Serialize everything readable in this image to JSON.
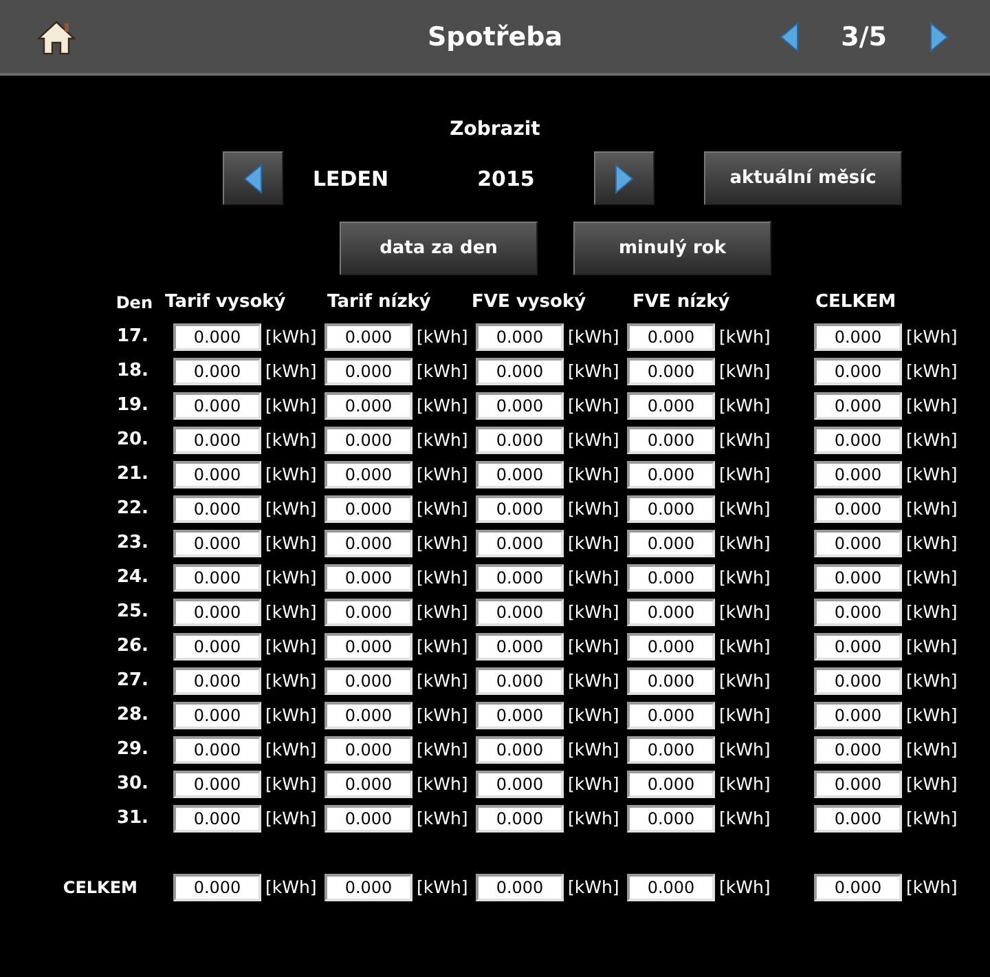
{
  "top_bar": {
    "title": "Spotřeba",
    "page": "3/5"
  },
  "period": {
    "label": "Zobrazit",
    "month": "LEDEN",
    "year": "2015",
    "buttons": [
      "aktuální měsíc",
      "data za den",
      "minulý rok"
    ]
  },
  "table": {
    "day_header": "Den",
    "columns": [
      "Tarif vysoký",
      "Tarif nízký",
      "FVE vysoký",
      "FVE nízký",
      "CELKEM"
    ],
    "rows": [
      {
        "day": "17.",
        "cells": [
          {
            "value": "0.000",
            "unit": "[kWh]"
          },
          {
            "value": "0.000",
            "unit": "[kWh]"
          },
          {
            "value": "0.000",
            "unit": "[kWh]"
          },
          {
            "value": "0.000",
            "unit": "[kWh]"
          },
          {
            "value": "0.000",
            "unit": "[kWh]"
          }
        ]
      },
      {
        "day": "18.",
        "cells": [
          {
            "value": "0.000",
            "unit": "[kWh]"
          },
          {
            "value": "0.000",
            "unit": "[kWh]"
          },
          {
            "value": "0.000",
            "unit": "[kWh]"
          },
          {
            "value": "0.000",
            "unit": "[kWh]"
          },
          {
            "value": "0.000",
            "unit": "[kWh]"
          }
        ]
      },
      {
        "day": "19.",
        "cells": [
          {
            "value": "0.000",
            "unit": "[kWh]"
          },
          {
            "value": "0.000",
            "unit": "[kWh]"
          },
          {
            "value": "0.000",
            "unit": "[kWh]"
          },
          {
            "value": "0.000",
            "unit": "[kWh]"
          },
          {
            "value": "0.000",
            "unit": "[kWh]"
          }
        ]
      },
      {
        "day": "20.",
        "cells": [
          {
            "value": "0.000",
            "unit": "[kWh]"
          },
          {
            "value": "0.000",
            "unit": "[kWh]"
          },
          {
            "value": "0.000",
            "unit": "[kWh]"
          },
          {
            "value": "0.000",
            "unit": "[kWh]"
          },
          {
            "value": "0.000",
            "unit": "[kWh]"
          }
        ]
      },
      {
        "day": "21.",
        "cells": [
          {
            "value": "0.000",
            "unit": "[kWh]"
          },
          {
            "value": "0.000",
            "unit": "[kWh]"
          },
          {
            "value": "0.000",
            "unit": "[kWh]"
          },
          {
            "value": "0.000",
            "unit": "[kWh]"
          },
          {
            "value": "0.000",
            "unit": "[kWh]"
          }
        ]
      },
      {
        "day": "22.",
        "cells": [
          {
            "value": "0.000",
            "unit": "[kWh]"
          },
          {
            "value": "0.000",
            "unit": "[kWh]"
          },
          {
            "value": "0.000",
            "unit": "[kWh]"
          },
          {
            "value": "0.000",
            "unit": "[kWh]"
          },
          {
            "value": "0.000",
            "unit": "[kWh]"
          }
        ]
      },
      {
        "day": "23.",
        "cells": [
          {
            "value": "0.000",
            "unit": "[kWh]"
          },
          {
            "value": "0.000",
            "unit": "[kWh]"
          },
          {
            "value": "0.000",
            "unit": "[kWh]"
          },
          {
            "value": "0.000",
            "unit": "[kWh]"
          },
          {
            "value": "0.000",
            "unit": "[kWh]"
          }
        ]
      },
      {
        "day": "24.",
        "cells": [
          {
            "value": "0.000",
            "unit": "[kWh]"
          },
          {
            "value": "0.000",
            "unit": "[kWh]"
          },
          {
            "value": "0.000",
            "unit": "[kWh]"
          },
          {
            "value": "0.000",
            "unit": "[kWh]"
          },
          {
            "value": "0.000",
            "unit": "[kWh]"
          }
        ]
      },
      {
        "day": "25.",
        "cells": [
          {
            "value": "0.000",
            "unit": "[kWh]"
          },
          {
            "value": "0.000",
            "unit": "[kWh]"
          },
          {
            "value": "0.000",
            "unit": "[kWh]"
          },
          {
            "value": "0.000",
            "unit": "[kWh]"
          },
          {
            "value": "0.000",
            "unit": "[kWh]"
          }
        ]
      },
      {
        "day": "26.",
        "cells": [
          {
            "value": "0.000",
            "unit": "[kWh]"
          },
          {
            "value": "0.000",
            "unit": "[kWh]"
          },
          {
            "value": "0.000",
            "unit": "[kWh]"
          },
          {
            "value": "0.000",
            "unit": "[kWh]"
          },
          {
            "value": "0.000",
            "unit": "[kWh]"
          }
        ]
      },
      {
        "day": "27.",
        "cells": [
          {
            "value": "0.000",
            "unit": "[kWh]"
          },
          {
            "value": "0.000",
            "unit": "[kWh]"
          },
          {
            "value": "0.000",
            "unit": "[kWh]"
          },
          {
            "value": "0.000",
            "unit": "[kWh]"
          },
          {
            "value": "0.000",
            "unit": "[kWh]"
          }
        ]
      },
      {
        "day": "28.",
        "cells": [
          {
            "value": "0.000",
            "unit": "[kWh]"
          },
          {
            "value": "0.000",
            "unit": "[kWh]"
          },
          {
            "value": "0.000",
            "unit": "[kWh]"
          },
          {
            "value": "0.000",
            "unit": "[kWh]"
          },
          {
            "value": "0.000",
            "unit": "[kWh]"
          }
        ]
      },
      {
        "day": "29.",
        "cells": [
          {
            "value": "0.000",
            "unit": "[kWh]"
          },
          {
            "value": "0.000",
            "unit": "[kWh]"
          },
          {
            "value": "0.000",
            "unit": "[kWh]"
          },
          {
            "value": "0.000",
            "unit": "[kWh]"
          },
          {
            "value": "0.000",
            "unit": "[kWh]"
          }
        ]
      },
      {
        "day": "30.",
        "cells": [
          {
            "value": "0.000",
            "unit": "[kWh]"
          },
          {
            "value": "0.000",
            "unit": "[kWh]"
          },
          {
            "value": "0.000",
            "unit": "[kWh]"
          },
          {
            "value": "0.000",
            "unit": "[kWh]"
          },
          {
            "value": "0.000",
            "unit": "[kWh]"
          }
        ]
      },
      {
        "day": "31.",
        "cells": [
          {
            "value": "0.000",
            "unit": "[kWh]"
          },
          {
            "value": "0.000",
            "unit": "[kWh]"
          },
          {
            "value": "0.000",
            "unit": "[kWh]"
          },
          {
            "value": "0.000",
            "unit": "[kWh]"
          },
          {
            "value": "0.000",
            "unit": "[kWh]"
          }
        ]
      }
    ],
    "total": {
      "label": "CELKEM",
      "cells": [
        {
          "value": "0.000",
          "unit": "[kWh]"
        },
        {
          "value": "0.000",
          "unit": "[kWh]"
        },
        {
          "value": "0.000",
          "unit": "[kWh]"
        },
        {
          "value": "0.000",
          "unit": "[kWh]"
        },
        {
          "value": "0.000",
          "unit": "[kWh]"
        }
      ]
    }
  }
}
